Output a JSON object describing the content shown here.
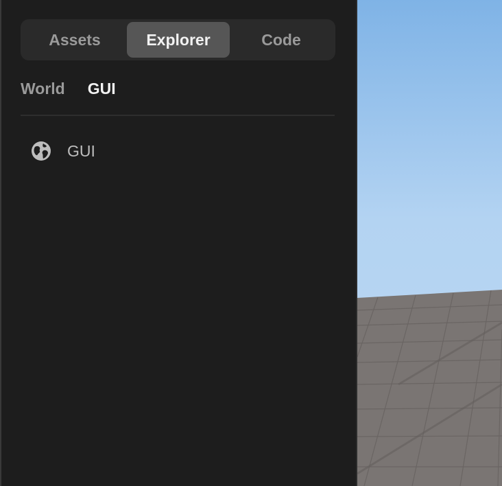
{
  "panel": {
    "tabs": [
      {
        "label": "Assets",
        "active": false
      },
      {
        "label": "Explorer",
        "active": true
      },
      {
        "label": "Code",
        "active": false
      }
    ],
    "subtabs": [
      {
        "label": "World",
        "active": false
      },
      {
        "label": "GUI",
        "active": true
      }
    ],
    "tree": [
      {
        "label": "GUI",
        "icon": "globe-icon"
      }
    ]
  },
  "colors": {
    "panel_bg": "#1d1d1d",
    "segmented_bg": "#2a2a2a",
    "active_tab_bg": "#565656",
    "sky_top": "#7fb3e6",
    "sky_bottom": "#bcd8f3",
    "ground": "#7a7573"
  }
}
